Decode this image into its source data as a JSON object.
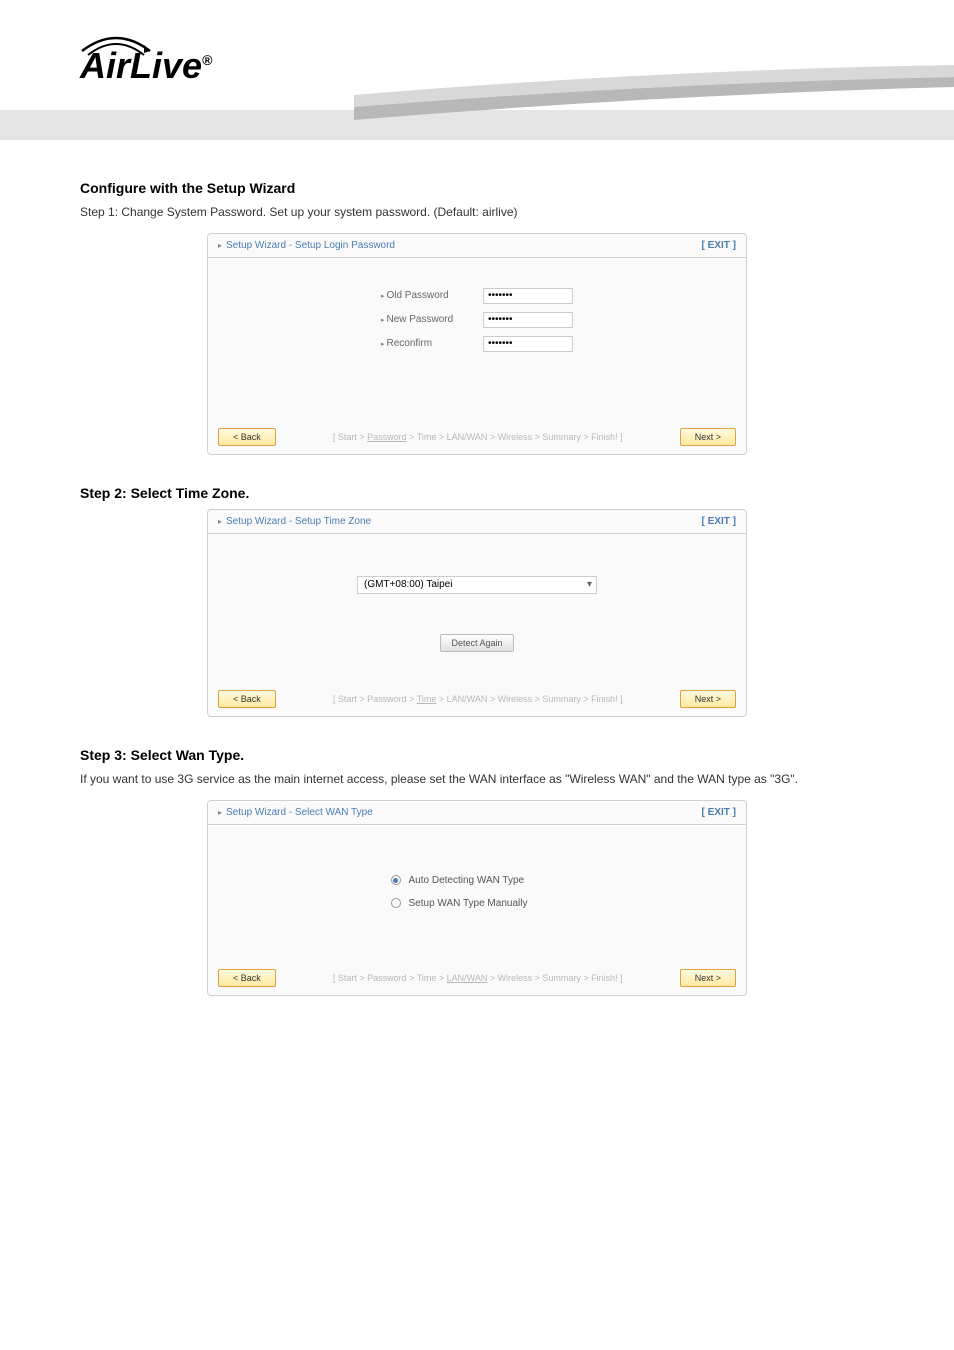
{
  "brand": "AirLive",
  "brand_sup": "®",
  "sections": {
    "password": {
      "heading": "Configure with the Setup Wizard",
      "desc": "Step 1: Change System Password. Set up your system password. (Default: airlive)",
      "card_title": "Setup Wizard - Setup Login Password",
      "exit": "[ EXIT ]",
      "old_label": "Old Password",
      "new_label": "New Password",
      "reconf_label": "Reconfirm",
      "masked": "•••••••",
      "back": "< Back",
      "next": "Next >",
      "trail_prefix": "[ Start > ",
      "trail_active": "Password",
      "trail_suffix": " > Time > LAN/WAN > Wireless > Summary > Finish! ]"
    },
    "timezone": {
      "heading": "Step 2: Select Time Zone.",
      "card_title": "Setup Wizard - Setup Time Zone",
      "exit": "[ EXIT ]",
      "selected": "(GMT+08:00) Taipei",
      "detect": "Detect Again",
      "back": "< Back",
      "next": "Next >",
      "trail_prefix": "[ Start > Password > ",
      "trail_active": "Time",
      "trail_suffix": " > LAN/WAN > Wireless > Summary > Finish! ]"
    },
    "wan": {
      "heading": "Step 3: Select Wan Type.",
      "desc": "If you want to use 3G service as the main internet access, please set the WAN interface as \"Wireless WAN\" and the WAN type as \"3G\".",
      "card_title": "Setup Wizard - Select WAN Type",
      "exit": "[ EXIT ]",
      "opt1": "Auto Detecting WAN Type",
      "opt2": "Setup WAN Type Manually",
      "back": "< Back",
      "next": "Next >",
      "trail_prefix": "[ Start > Password > Time > ",
      "trail_active": "LAN/WAN",
      "trail_suffix": " > Wireless > Summary > Finish! ]"
    }
  }
}
